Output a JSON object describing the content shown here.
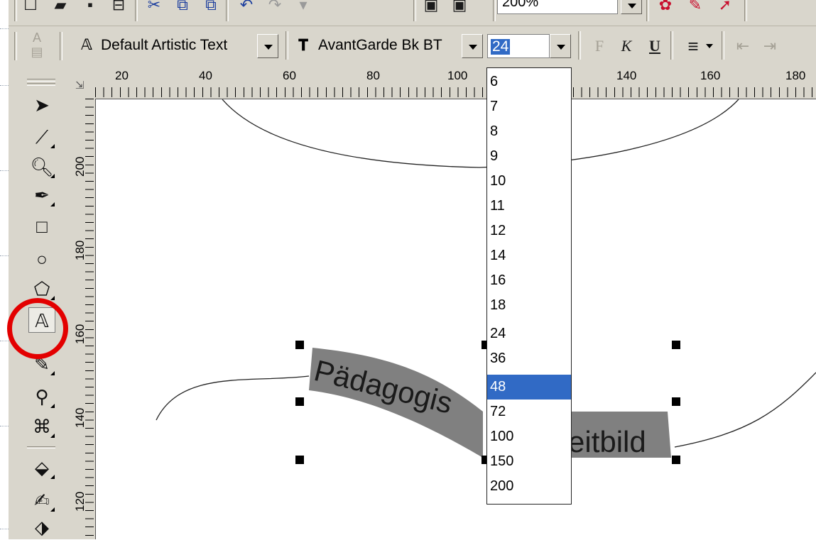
{
  "toolbar": {
    "zoom_value": "200%",
    "style_combo": {
      "icon": "artistic-text-icon",
      "value": "Default Artistic Text"
    },
    "font_combo": {
      "icon": "truetype-font-icon",
      "value": "AvantGarde Bk BT"
    },
    "size_combo": {
      "value": "24"
    },
    "format": {
      "bold": "F",
      "italic": "K",
      "underline": "U",
      "align": "≡"
    }
  },
  "rulers": {
    "horizontal": [
      "20",
      "40",
      "60",
      "80",
      "100",
      "140",
      "160",
      "180"
    ],
    "vertical": [
      "200",
      "180",
      "160",
      "140",
      "120"
    ]
  },
  "font_size_list": {
    "options": [
      "6",
      "7",
      "8",
      "9",
      "10",
      "11",
      "12",
      "14",
      "16",
      "18",
      "24",
      "36",
      "48",
      "72",
      "100",
      "150",
      "200"
    ],
    "selected": "48"
  },
  "canvas": {
    "text_on_path": "Pädagogisches Leitbild",
    "visible_left": "Pädagogis",
    "visible_right": "eitbild"
  },
  "colors": {
    "highlight_ring": "#e30000",
    "selection": "#316ac5",
    "text_fill": "#808080"
  }
}
